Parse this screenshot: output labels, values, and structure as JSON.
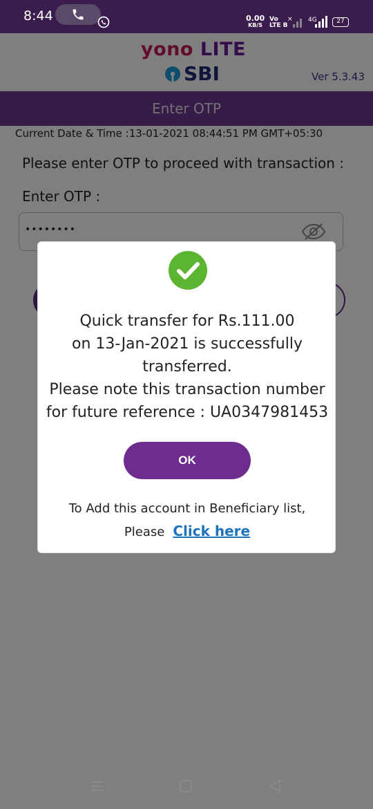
{
  "status_bar": {
    "time": "8:44",
    "net_speed_value": "0.00",
    "net_speed_unit": "KB/S",
    "volte_top": "Vo",
    "volte_bottom": "LTE B",
    "network_type": "4G",
    "battery": "27"
  },
  "header": {
    "logo_word": "yono",
    "logo_suffix": " LITE",
    "bank_logo_text": "SBI",
    "version": "Ver 5.3.43"
  },
  "page": {
    "title": "Enter OTP",
    "datetime": "Current Date & Time :13-01-2021 08:44:51 PM GMT+05:30",
    "instruction": "Please enter OTP to proceed with transaction :",
    "otp_label": "Enter OTP :",
    "otp_value": "••••••••"
  },
  "dialog": {
    "message_line1": "Quick transfer for Rs.111.00",
    "message_line2": "on 13-Jan-2021 is successfully",
    "message_line3": "transferred.",
    "message_line4": "Please note this transaction number",
    "message_line5": "for future reference : UA0347981453",
    "ok_label": "OK",
    "beneficiary_text": "To Add this account in Beneficiary list,",
    "please_text": "Please",
    "click_here_label": "Click here"
  },
  "colors": {
    "status_bar": "#3a1d4d",
    "title_bar": "#6c3a8e",
    "ok_button": "#6e2c8e",
    "link": "#1e73be",
    "check": "#5cb531"
  }
}
